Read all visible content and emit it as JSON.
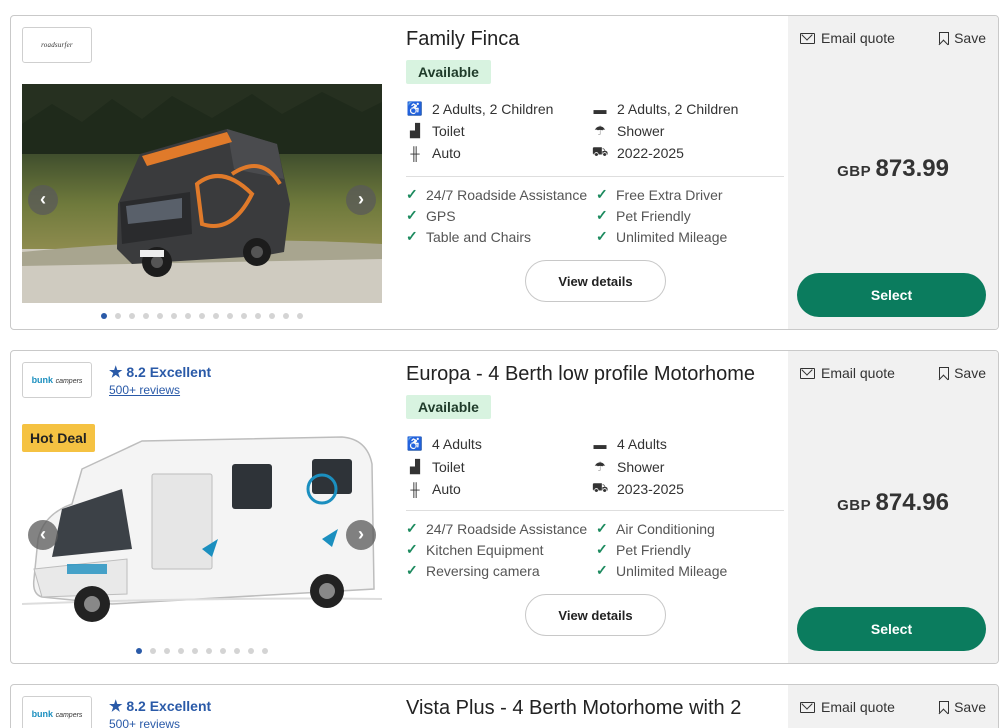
{
  "listings": [
    {
      "brand": "roadsurfer",
      "title": "Family Finca",
      "availability": "Available",
      "specs": {
        "seats": "2 Adults, 2 Children",
        "beds": "2 Adults, 2 Children",
        "toilet": "Toilet",
        "shower": "Shower",
        "transmission": "Auto",
        "years": "2022-2025"
      },
      "features": [
        "24/7 Roadside Assistance",
        "Free Extra Driver",
        "GPS",
        "Pet Friendly",
        "Table and Chairs",
        "Unlimited Mileage"
      ],
      "view_details": "View details",
      "email_quote": "Email quote",
      "save": "Save",
      "currency": "GBP",
      "price": "873.99",
      "select": "Select",
      "photo_dots": 15
    },
    {
      "brand": "bunk campers",
      "rating": "8.2 Excellent",
      "reviews": "500+ reviews",
      "badge": "Hot Deal",
      "title": "Europa - 4 Berth low profile Motorhome",
      "availability": "Available",
      "specs": {
        "seats": "4 Adults",
        "beds": "4 Adults",
        "toilet": "Toilet",
        "shower": "Shower",
        "transmission": "Auto",
        "years": "2023-2025"
      },
      "features": [
        "24/7 Roadside Assistance",
        "Air Conditioning",
        "Kitchen Equipment",
        "Pet Friendly",
        "Reversing camera",
        "Unlimited Mileage"
      ],
      "view_details": "View details",
      "email_quote": "Email quote",
      "save": "Save",
      "currency": "GBP",
      "price": "874.96",
      "select": "Select",
      "photo_dots": 10
    },
    {
      "brand": "bunk campers",
      "rating": "8.2 Excellent",
      "reviews": "500+ reviews",
      "title": "Vista Plus - 4 Berth Motorhome with 2",
      "email_quote": "Email quote",
      "save": "Save"
    }
  ],
  "logo_text": {
    "roadsurfer": "roadsurfer",
    "bunk_main": "bunk",
    "bunk_sub": "campers"
  },
  "colors": {
    "select_button": "#0b7c5e",
    "available_badge": "#d8f3e0",
    "hot_deal": "#f5c242",
    "rating_blue": "#2a5aa8",
    "check_green": "#1c8a5e"
  }
}
